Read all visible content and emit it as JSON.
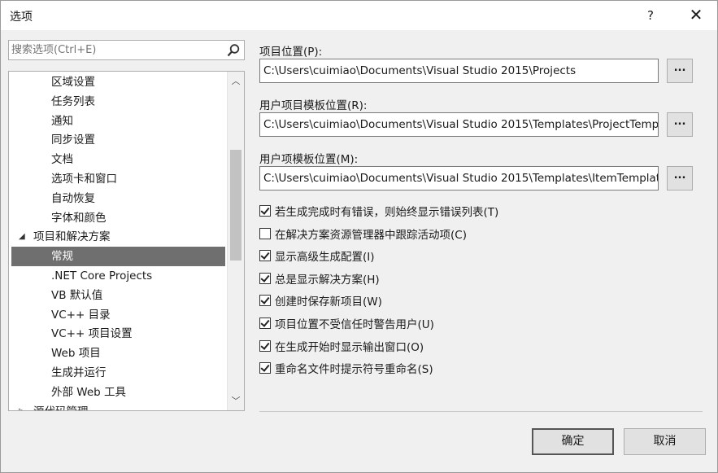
{
  "window": {
    "title": "选项",
    "help_label": "?",
    "close_label": "✕"
  },
  "search": {
    "placeholder": "搜索选项(Ctrl+E)"
  },
  "tree": {
    "items": [
      {
        "label": "区域设置",
        "level": "child"
      },
      {
        "label": "任务列表",
        "level": "child"
      },
      {
        "label": "通知",
        "level": "child"
      },
      {
        "label": "同步设置",
        "level": "child"
      },
      {
        "label": "文档",
        "level": "child"
      },
      {
        "label": "选项卡和窗口",
        "level": "child"
      },
      {
        "label": "自动恢复",
        "level": "child"
      },
      {
        "label": "字体和颜色",
        "level": "child"
      },
      {
        "label": "项目和解决方案",
        "level": "parent",
        "expander": "◢"
      },
      {
        "label": "常规",
        "level": "child",
        "selected": true
      },
      {
        "label": ".NET Core Projects",
        "level": "child"
      },
      {
        "label": "VB 默认值",
        "level": "child"
      },
      {
        "label": "VC++ 目录",
        "level": "child"
      },
      {
        "label": "VC++ 项目设置",
        "level": "child"
      },
      {
        "label": "Web 项目",
        "level": "child"
      },
      {
        "label": "生成并运行",
        "level": "child"
      },
      {
        "label": "外部 Web 工具",
        "level": "child"
      },
      {
        "label": "源代码管理",
        "level": "parent",
        "expander": "▷"
      }
    ]
  },
  "fields": {
    "project_location": {
      "label": "项目位置(P):",
      "value": "C:\\Users\\cuimiao\\Documents\\Visual Studio 2015\\Projects"
    },
    "project_templates": {
      "label": "用户项目模板位置(R):",
      "value": "C:\\Users\\cuimiao\\Documents\\Visual Studio 2015\\Templates\\ProjectTemplates"
    },
    "item_templates": {
      "label": "用户项模板位置(M):",
      "value": "C:\\Users\\cuimiao\\Documents\\Visual Studio 2015\\Templates\\ItemTemplates"
    },
    "browse_label": "..."
  },
  "checks": [
    {
      "label": "若生成完成时有错误，则始终显示错误列表(T)",
      "checked": true
    },
    {
      "label": "在解决方案资源管理器中跟踪活动项(C)",
      "checked": false
    },
    {
      "label": "显示高级生成配置(I)",
      "checked": true
    },
    {
      "label": "总是显示解决方案(H)",
      "checked": true
    },
    {
      "label": "创建时保存新项目(W)",
      "checked": true
    },
    {
      "label": "项目位置不受信任时警告用户(U)",
      "checked": true
    },
    {
      "label": "在生成开始时显示输出窗口(O)",
      "checked": true
    },
    {
      "label": "重命名文件时提示符号重命名(S)",
      "checked": true
    }
  ],
  "buttons": {
    "ok": "确定",
    "cancel": "取消"
  }
}
